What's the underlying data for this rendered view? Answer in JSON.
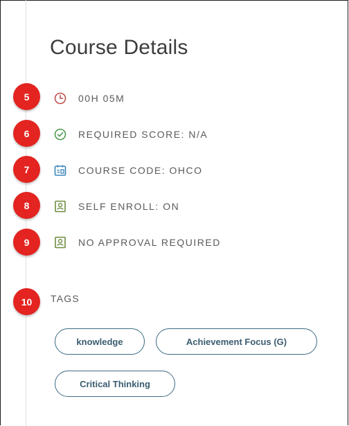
{
  "page": {
    "title": "Course Details"
  },
  "details": [
    {
      "step": "5",
      "icon": "clock-icon",
      "text": "00H 05M",
      "color": "#c0504d"
    },
    {
      "step": "6",
      "icon": "check-circle-icon",
      "text": "REQUIRED SCORE: N/A",
      "color": "#4f9a4f"
    },
    {
      "step": "7",
      "icon": "calendar-code-icon",
      "text": "COURSE CODE: OHCO",
      "color": "#3a86b8"
    },
    {
      "step": "8",
      "icon": "id-card-icon",
      "text": "SELF ENROLL: ON",
      "color": "#6e8b3d"
    },
    {
      "step": "9",
      "icon": "id-card-icon",
      "text": "NO APPROVAL REQUIRED",
      "color": "#6e8b3d"
    }
  ],
  "tags": {
    "step": "10",
    "label": "TAGS",
    "items": [
      "knowledge",
      "Achievement Focus (G)",
      "Critical Thinking"
    ]
  },
  "colors": {
    "badge": "#e32420",
    "tag_border": "#3d6b84"
  }
}
